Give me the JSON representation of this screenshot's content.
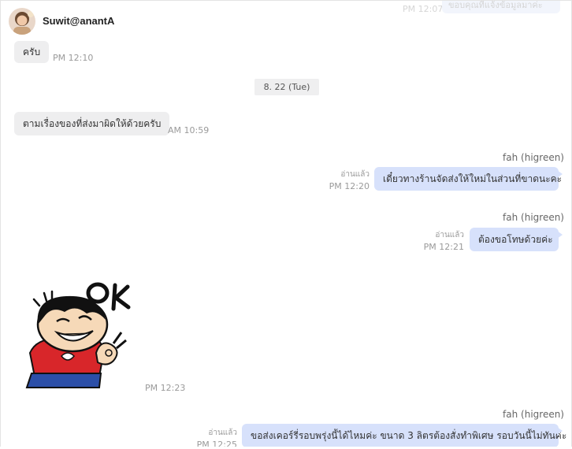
{
  "header": {
    "name": "Suwit@anantA"
  },
  "ghost_top": {
    "time": "PM 12:07",
    "text": "ขอบคุณที่แจ้งข้อมูลมาค่ะ"
  },
  "date_divider": "8. 22 (Tue)",
  "messages": [
    {
      "dir": "in",
      "text": "ครับ",
      "time": "PM 12:10"
    },
    {
      "dir": "in",
      "text": "ตามเรื่องของที่ส่งมาผิดให้ด้วยครับ",
      "time": "AM 10:59"
    },
    {
      "dir": "out",
      "sender": "fah (higreen)",
      "read": "อ่านแล้ว",
      "text": "เดี๋ยวทางร้านจัดส่งให้ใหม่ในส่วนที่ขาดนะคะ",
      "time": "PM 12:20"
    },
    {
      "dir": "out",
      "sender": "fah (higreen)",
      "read": "อ่านแล้ว",
      "text": "ต้องขอโทษด้วยค่ะ",
      "time": "PM 12:21"
    },
    {
      "dir": "in",
      "type": "sticker",
      "sticker_text": "OK",
      "time": "PM 12:23"
    },
    {
      "dir": "out",
      "sender": "fah (higreen)",
      "read": "อ่านแล้ว",
      "text": "ขอส่งเคอร์รี่รอบพรุ่งนี้ได้ไหมค่ะ ขนาด 3 ลิตรต้องสั่งทำพิเศษ รอบวันนี้ไม่ทันค่ะ",
      "time": "PM 12:25"
    }
  ],
  "colors": {
    "incoming_bubble": "#eeeeef",
    "outgoing_bubble": "#d7e1fb",
    "timestamp": "#9a9a9a"
  },
  "icons": {
    "avatar": "user-avatar-photo",
    "sticker": "ok-cartoon-boy-sticker"
  }
}
